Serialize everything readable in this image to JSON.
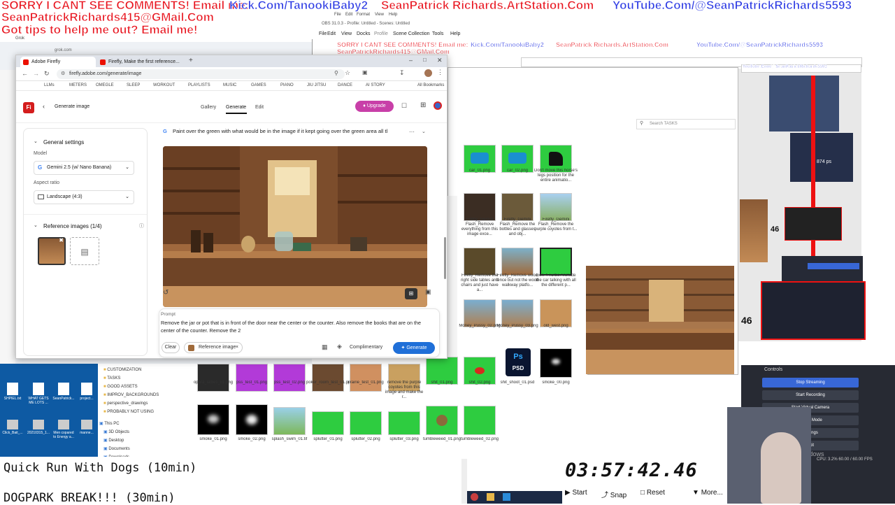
{
  "overlay": {
    "line1": "SORRY I CANT SEE COMMENTS! Email me:",
    "line2": "SeanPatrickRichards415@GMail.Com",
    "line3": "Got tips to help me out? Email me!",
    "link_kick": "Kick.Com/TanookiBaby2",
    "link_artstation": "SeanPatrick Richards.ArtStation.Com",
    "link_youtube": "YouTube.Com/@SeanPatrickRichards5593"
  },
  "obs_window": {
    "title": "OBS 31.0.3 - Profile: Untitled - Scenes: Untitled",
    "menu": [
      "File",
      "Edit",
      "View",
      "Docks",
      "Profile",
      "Scene Collection",
      "Tools",
      "Help"
    ]
  },
  "inner_menu": [
    "File",
    "Edit",
    "Format",
    "View",
    "Help"
  ],
  "explorer": {
    "search_placeholder": "Search TASKS",
    "folders": [
      "CUSTOMIZATION",
      "TASKS",
      "GOOD ASSETS",
      "IMPROV_BACKGROUNDS",
      "perspective_drawings",
      "PROBABLY NOT USING"
    ],
    "nav": [
      "This PC",
      "3D Objects",
      "Desktop",
      "Documents",
      "Downloads"
    ],
    "files_top": [
      {
        "name": "car_01.png",
        "color": "#2ecc40"
      },
      {
        "name": "car_02.png",
        "color": "#2ecc40"
      },
      {
        "name": "Don't move this horse's legs position for the entire animatio...",
        "color": "#2ecc40"
      }
    ],
    "files_row2": [
      {
        "name": "Firefly_Gemini Flash_Remove everything from this image exce...",
        "color": "#3b2d23"
      },
      {
        "name": "Firefly_Gemini Flash_Remove the bottles and glasses and obj...",
        "color": "#6b5a3a"
      },
      {
        "name": "Firefly_Gemini Flash_Remove the purple coyotes from t...",
        "color": "#89b064"
      }
    ],
    "files_row3": [
      {
        "name": "Firefly_Remove the right side tables and chairs and just have a...",
        "color": "#5a4a2a"
      },
      {
        "name": "Firefly_Remove wood fence but not the wood walkway platfo...",
        "color": "#7db0c8"
      },
      {
        "name": "Gen-4 Turbo Animate the car talking with all the different p...",
        "color": "#2ecc40"
      }
    ],
    "files_row4": [
      {
        "name": "Money_Pussy_02.png",
        "color": "#7aaed0"
      },
      {
        "name": "Money_Pussy_03.png",
        "color": "#7aaed0"
      },
      {
        "name": "old_west.png",
        "color": "#c9945a"
      }
    ],
    "files_row5": [
      {
        "name": "opera_ladies_01.png",
        "color": "#2a2a2a"
      },
      {
        "name": "pss_test_01.png",
        "color": "#b23ad8"
      },
      {
        "name": "pss_test_02.png",
        "color": "#b23ad8"
      },
      {
        "name": "poker_room_test_01.png",
        "color": "#6b4a30"
      },
      {
        "name": "prairie_test_01.png",
        "color": "#d09060"
      },
      {
        "name": "remove the purple coyotes from this image and make the r...",
        "color": "#c9a060"
      },
      {
        "name": "shit_01.png",
        "color": "#2ecc40"
      },
      {
        "name": "shit_02.png",
        "color": "#2ecc40"
      },
      {
        "name": "shit_shoot_01.psd",
        "color": "#0a1530"
      },
      {
        "name": "smoke_00.png",
        "color": "#000000"
      }
    ],
    "files_row6": [
      {
        "name": "smoke_01.png",
        "color": "#000000"
      },
      {
        "name": "smoke_02.png",
        "color": "#000000"
      },
      {
        "name": "splash_swim_01.tif",
        "color": "#9ad0e8"
      },
      {
        "name": "splutter_01.png",
        "color": "#2ecc40"
      },
      {
        "name": "splutter_02.png",
        "color": "#2ecc40"
      },
      {
        "name": "splutter_03.png",
        "color": "#2ecc40"
      },
      {
        "name": "tumbleweed_01.png",
        "color": "#2ecc40"
      },
      {
        "name": "tumbleweed_02.png",
        "color": "#2ecc40"
      }
    ],
    "psd_label": "Ps\nPSD"
  },
  "desktop_icons": [
    "SHPIEL.txt",
    "WHAT GETS ME LOTS ...",
    "SeanPatrick...",
    "project...",
    "Click_Bait_...",
    "20210315_1...",
    "Men copared to Energy a...",
    "manne..."
  ],
  "browser": {
    "tabs": [
      {
        "label": "Adobe Firefly"
      },
      {
        "label": "Firefly, Make the first reference..."
      }
    ],
    "bg_tab": "Grok",
    "bg_url": "grok.com",
    "url": "firefly.adobe.com/generate/image",
    "bookmarks": [
      "LLMs",
      "METERS",
      "OMEGLE",
      "SLEEP",
      "WORKOUT",
      "PLAYLISTS",
      "MUSIC",
      "GAMES",
      "PIANO",
      "JIU JITSU",
      "DANCE",
      "AI STORY",
      "All Bookmarks"
    ]
  },
  "firefly": {
    "logo": "Fi",
    "back_label": "Generate image",
    "nav": [
      "Gallery",
      "Generate",
      "Edit"
    ],
    "upgrade": "Upgrade",
    "general_settings": "General settings",
    "model_label": "Model",
    "model_value": "Gemini 2.5 (w/ Nano Banana)",
    "aspect_label": "Aspect ratio",
    "aspect_value": "Landscape (4:3)",
    "ref_label": "Reference images (1/4)",
    "prompt_header": "Paint over the green with what would be in the image if it kept going over the green area all tl",
    "prompt_label": "Prompt",
    "prompt_text": "Remove the jar or pot that is in front of the door near the center or the counter. Also remove the books that are on the center of the counter. Remove the 2",
    "clear": "Clear",
    "ref_chip": "Reference image",
    "complimentary": "Complimentary",
    "generate": "Generate",
    "brand_color": "#1f6fd8",
    "upgrade_color": "#c83fa8"
  },
  "obs": {
    "controls_title": "Controls",
    "buttons": [
      "Stop Streaming",
      "Start Recording",
      "Start Virtual Camera",
      "Studio Mode",
      "Settings",
      "Exit"
    ],
    "status": "CPU: 3.2%  60.00 / 60.00 FPS",
    "windows_watermark": "Windows"
  },
  "tasks": {
    "line1": "Quick Run With Dogs (10min)",
    "line2": "DOGPARK BREAK!!! (30min)"
  },
  "timer": {
    "value": "03:57:42.46",
    "start": "Start",
    "snap": "Snap",
    "reset": "Reset",
    "more": "More..."
  },
  "preview_small": {
    "fps": "874 ps",
    "num1": "46",
    "num2": "46"
  }
}
